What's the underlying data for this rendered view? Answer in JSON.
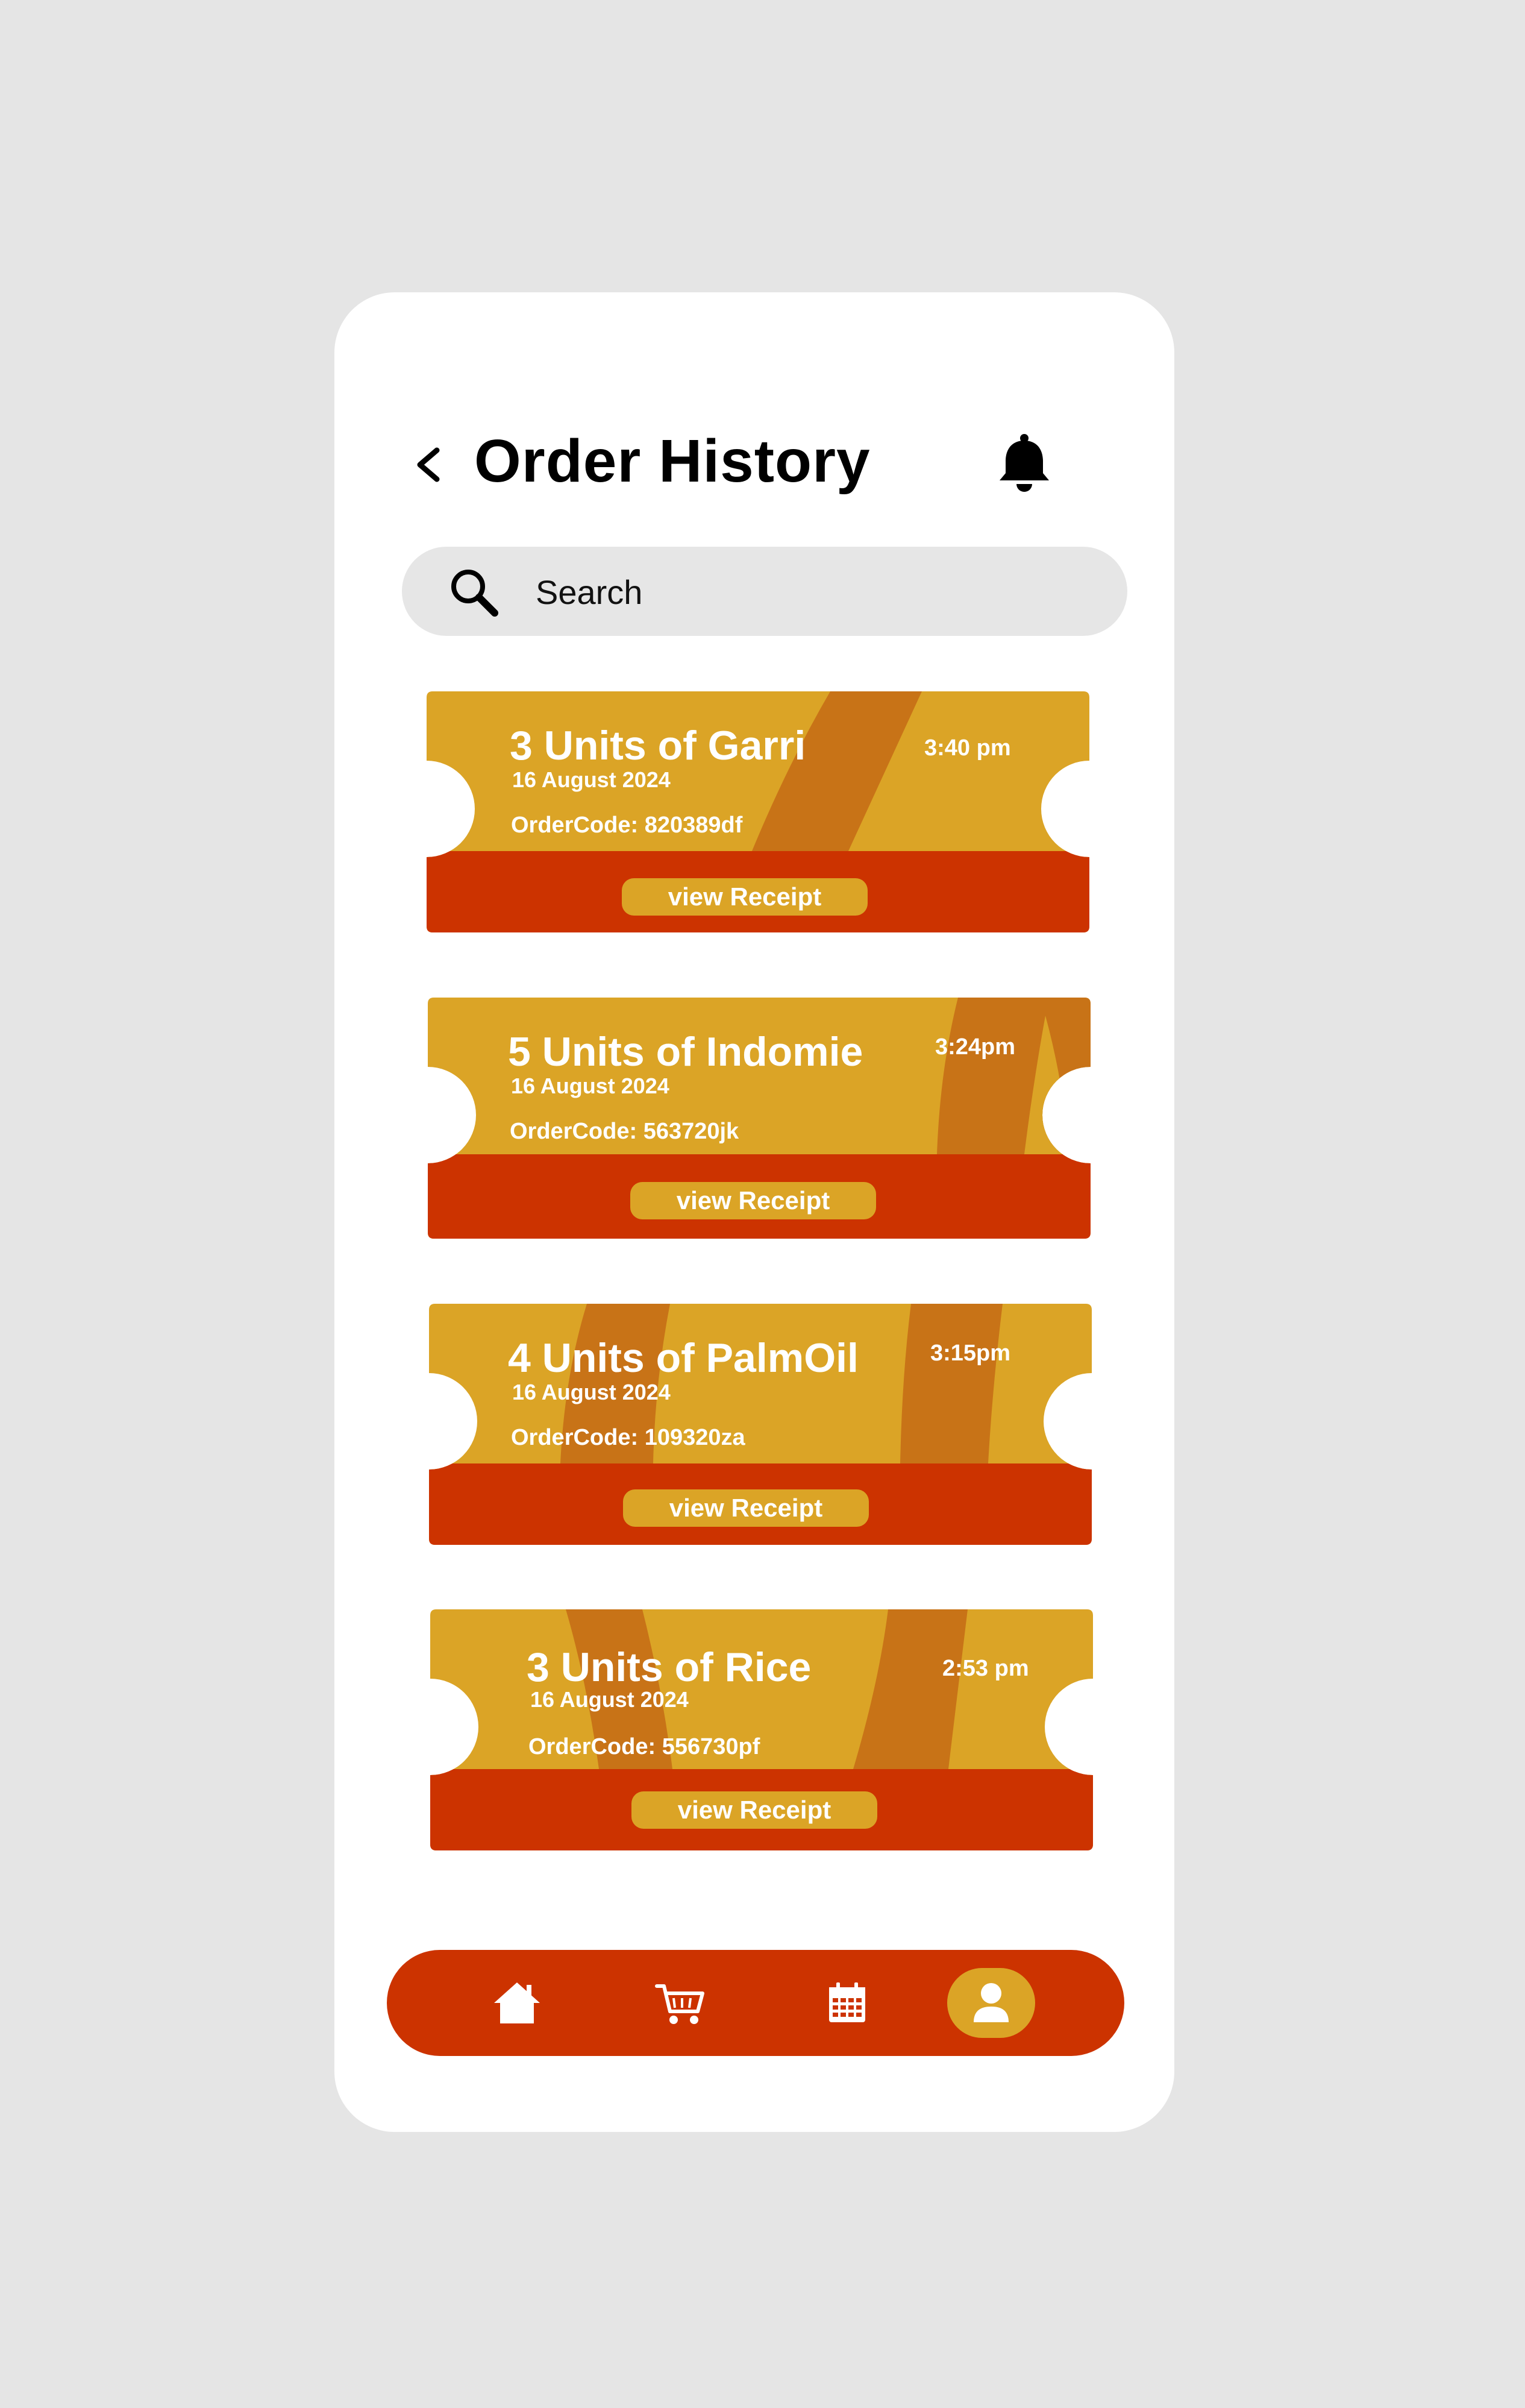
{
  "header": {
    "title": "Order History"
  },
  "search": {
    "placeholder": "Search"
  },
  "orders": [
    {
      "title": "3 Units of Garri",
      "date": "16 August 2024",
      "order_code": "OrderCode: 820389df",
      "time": "3:40 pm",
      "button_label": "view Receipt"
    },
    {
      "title": "5 Units of Indomie",
      "date": "16 August 2024",
      "order_code": "OrderCode: 563720jk",
      "time": "3:24pm",
      "button_label": "view Receipt"
    },
    {
      "title": "4 Units of PalmOil",
      "date": "16 August 2024",
      "order_code": "OrderCode: 109320za",
      "time": "3:15pm",
      "button_label": "view Receipt"
    },
    {
      "title": "3 Units of Rice",
      "date": "16 August 2024",
      "order_code": "OrderCode: 556730pf",
      "time": "2:53 pm",
      "button_label": "view Receipt"
    }
  ],
  "bottom_nav": {
    "items": [
      {
        "icon": "home-icon"
      },
      {
        "icon": "cart-icon"
      },
      {
        "icon": "calendar-icon"
      },
      {
        "icon": "profile-icon",
        "active": true
      }
    ]
  },
  "colors": {
    "ticket_gold": "#dba426",
    "ticket_stripe": "#c87317",
    "ticket_red": "#cc3300",
    "background": "#e5e5e5",
    "card": "#ffffff"
  }
}
